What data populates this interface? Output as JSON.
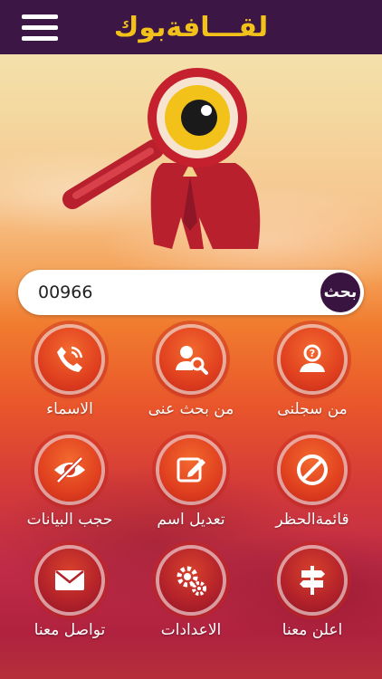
{
  "header": {
    "logo_text": "لقـــافةبوك"
  },
  "search": {
    "value": "00966",
    "button_label": "بحث"
  },
  "grid": [
    {
      "label": "من سجلنى",
      "icon": "person-question-icon"
    },
    {
      "label": "من بحث عنى",
      "icon": "user-search-icon"
    },
    {
      "label": "الاسماء",
      "icon": "phone-call-icon"
    },
    {
      "label": "قائمةالحظر",
      "icon": "block-icon"
    },
    {
      "label": "تعديل اسم",
      "icon": "edit-icon"
    },
    {
      "label": "حجب البيانات",
      "icon": "eye-off-icon"
    },
    {
      "label": "اعلن معنا",
      "icon": "signpost-icon"
    },
    {
      "label": "الاعدادات",
      "icon": "settings-icon"
    },
    {
      "label": "تواصل معنا",
      "icon": "mail-icon"
    }
  ],
  "colors": {
    "header_bg": "#3c1644",
    "logo": "#f2c21b",
    "search_button": "#3a1440",
    "tile": "#e0401f"
  }
}
